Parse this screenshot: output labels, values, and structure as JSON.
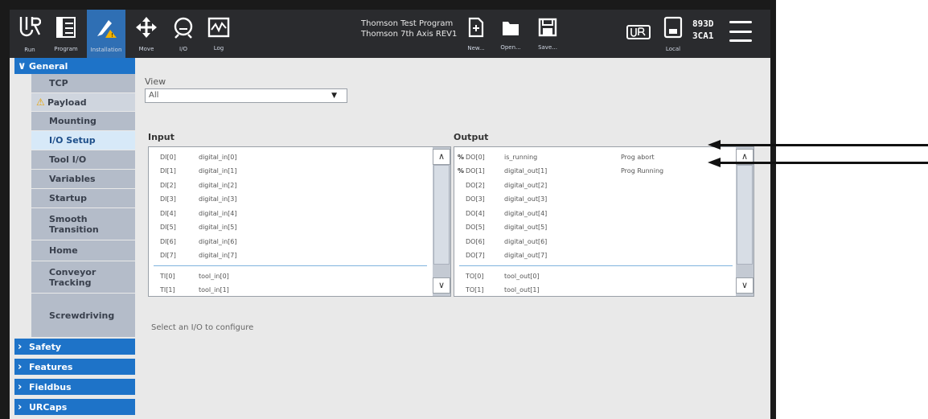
{
  "header": {
    "nav": [
      {
        "label": "Run",
        "icon": "ur-logo-icon"
      },
      {
        "label": "Program",
        "icon": "program-icon"
      },
      {
        "label": "Installation",
        "icon": "installation-icon"
      },
      {
        "label": "Move",
        "icon": "move-icon"
      },
      {
        "label": "I/O",
        "icon": "io-icon"
      },
      {
        "label": "Log",
        "icon": "log-icon"
      }
    ],
    "program_name": "Thomson Test Program",
    "installation_name": "Thomson 7th Axis REV1",
    "file": [
      {
        "label": "New...",
        "icon": "new-file-icon"
      },
      {
        "label": "Open...",
        "icon": "open-folder-icon"
      },
      {
        "label": "Save...",
        "icon": "save-icon"
      }
    ],
    "local_label": "Local",
    "serial_line1": "893D",
    "serial_line2": "3CA1"
  },
  "sidebar": {
    "general": "General",
    "items": [
      {
        "label": "TCP",
        "selected": false,
        "warning": false
      },
      {
        "label": "Payload",
        "selected": false,
        "warning": true
      },
      {
        "label": "Mounting",
        "selected": false,
        "warning": false
      },
      {
        "label": "I/O Setup",
        "selected": true,
        "warning": false
      },
      {
        "label": "Tool I/O",
        "selected": false,
        "warning": false
      },
      {
        "label": "Variables",
        "selected": false,
        "warning": false
      },
      {
        "label": "Startup",
        "selected": false,
        "warning": false
      },
      {
        "label": "Smooth Transition",
        "selected": false,
        "warning": false
      },
      {
        "label": "Home",
        "selected": false,
        "warning": false
      },
      {
        "label": "Conveyor Tracking",
        "selected": false,
        "warning": false
      },
      {
        "label": "Screwdriving",
        "selected": false,
        "warning": false
      }
    ],
    "sections": [
      "Safety",
      "Features",
      "Fieldbus",
      "URCaps"
    ]
  },
  "main": {
    "view_label": "View",
    "view_value": "All",
    "input_title": "Input",
    "output_title": "Output",
    "inputs": [
      {
        "pin": "DI[0]",
        "name": "digital_in[0]"
      },
      {
        "pin": "DI[1]",
        "name": "digital_in[1]"
      },
      {
        "pin": "DI[2]",
        "name": "digital_in[2]"
      },
      {
        "pin": "DI[3]",
        "name": "digital_in[3]"
      },
      {
        "pin": "DI[4]",
        "name": "digital_in[4]"
      },
      {
        "pin": "DI[5]",
        "name": "digital_in[5]"
      },
      {
        "pin": "DI[6]",
        "name": "digital_in[6]"
      },
      {
        "pin": "DI[7]",
        "name": "digital_in[7]"
      },
      {
        "pin": "TI[0]",
        "name": "tool_in[0]"
      },
      {
        "pin": "TI[1]",
        "name": "tool_in[1]"
      }
    ],
    "outputs": [
      {
        "mark": "%",
        "pin": "DO[0]",
        "name": "is_running",
        "func": "Prog abort"
      },
      {
        "mark": "%",
        "pin": "DO[1]",
        "name": "digital_out[1]",
        "func": "Prog Running"
      },
      {
        "mark": "",
        "pin": "DO[2]",
        "name": "digital_out[2]",
        "func": ""
      },
      {
        "mark": "",
        "pin": "DO[3]",
        "name": "digital_out[3]",
        "func": ""
      },
      {
        "mark": "",
        "pin": "DO[4]",
        "name": "digital_out[4]",
        "func": ""
      },
      {
        "mark": "",
        "pin": "DO[5]",
        "name": "digital_out[5]",
        "func": ""
      },
      {
        "mark": "",
        "pin": "DO[6]",
        "name": "digital_out[6]",
        "func": ""
      },
      {
        "mark": "",
        "pin": "DO[7]",
        "name": "digital_out[7]",
        "func": ""
      },
      {
        "mark": "",
        "pin": "TO[0]",
        "name": "tool_out[0]",
        "func": ""
      },
      {
        "mark": "",
        "pin": "TO[1]",
        "name": "tool_out[1]",
        "func": ""
      }
    ],
    "hint": "Select an I/O to configure"
  },
  "colors": {
    "header": "#2a2b2e",
    "accent": "#1e73c8",
    "submenu": "#b4bcc9",
    "selected": "#d7e9f8",
    "warning": "#e8a300"
  }
}
